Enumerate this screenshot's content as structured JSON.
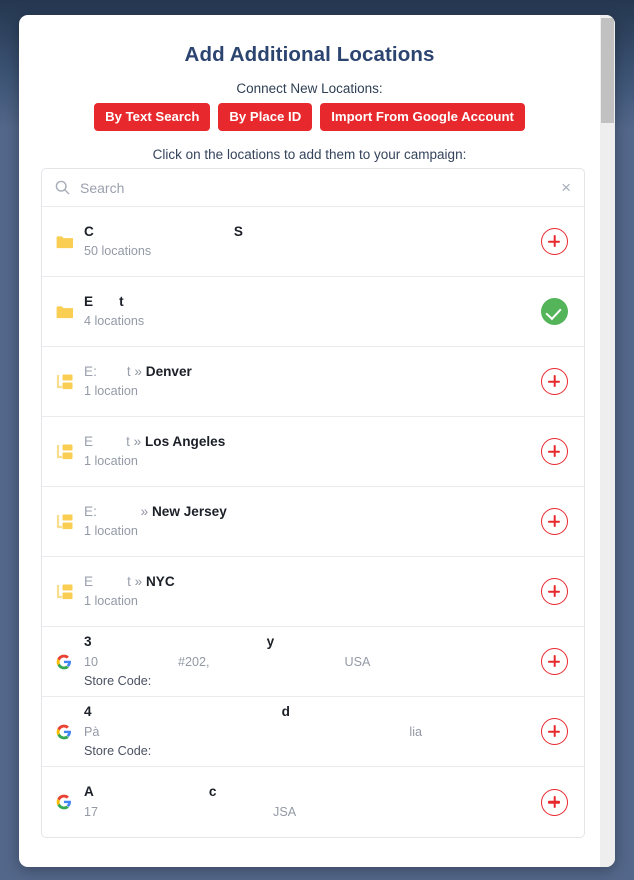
{
  "modal": {
    "title": "Add Additional Locations",
    "connect_label": "Connect New Locations:",
    "instruction": "Click on the locations to add them to your campaign:",
    "buttons": {
      "text_search": "By Text Search",
      "place_id": "By Place ID",
      "import_google": "Import From Google Account"
    }
  },
  "search": {
    "placeholder": "Search",
    "value": "",
    "clear_label": "×",
    "icon": "search-icon"
  },
  "colors": {
    "accent_red": "#e7282d",
    "success_green": "#54b45a",
    "title_navy": "#2c4470",
    "folder_yellow": "#f7c948",
    "backdrop": "#53678a"
  },
  "list": [
    {
      "icon": "folder-icon",
      "name_prefix": "C",
      "name_gap": 140,
      "name_suffix": "S",
      "count": "50 locations",
      "action": "add",
      "action_label": "+"
    },
    {
      "icon": "folder-icon",
      "name_prefix": "E",
      "name_gap": 26,
      "name_suffix": "t",
      "count": "4 locations",
      "action": "done",
      "action_label": "✓"
    },
    {
      "icon": "subfolder-icon",
      "parent_prefix": "E:",
      "parent_gap": 30,
      "parent_suffix": "t",
      "separator": "»",
      "child": "Denver",
      "count": "1 location",
      "action": "add",
      "action_label": "+"
    },
    {
      "icon": "subfolder-icon",
      "parent_prefix": "E",
      "parent_gap": 33,
      "parent_suffix": "t",
      "separator": "»",
      "child": "Los Angeles",
      "count": "1 location",
      "action": "add",
      "action_label": "+"
    },
    {
      "icon": "subfolder-icon",
      "parent_prefix": "E:",
      "parent_gap": 40,
      "parent_suffix": "",
      "separator": "»",
      "child": "New Jersey",
      "count": "1 location",
      "action": "add",
      "action_label": "+"
    },
    {
      "icon": "subfolder-icon",
      "parent_prefix": "E",
      "parent_gap": 34,
      "parent_suffix": "t",
      "separator": "»",
      "child": "NYC",
      "count": "1 location",
      "action": "add",
      "action_label": "+"
    },
    {
      "icon": "google-icon",
      "name_prefix": "3",
      "name_gap": 175,
      "name_suffix": "y",
      "addr_prefix": "10",
      "addr_gap1": 80,
      "addr_mid": "#202,",
      "addr_gap2": 135,
      "addr_suffix": "USA",
      "store_code": "Store Code:",
      "action": "add",
      "action_label": "+"
    },
    {
      "icon": "google-icon",
      "name_prefix": "4",
      "name_gap": 190,
      "name_suffix": "d",
      "addr_prefix": "Pà",
      "addr_gap1": 310,
      "addr_mid": "lia",
      "addr_gap2": 0,
      "addr_suffix": "",
      "store_code": "Store Code:",
      "action": "add",
      "action_label": "+"
    },
    {
      "icon": "google-icon",
      "name_prefix": "A",
      "name_gap": 115,
      "name_suffix": "c",
      "addr_prefix": "17",
      "addr_gap1": 175,
      "addr_mid": "JSA",
      "addr_gap2": 0,
      "addr_suffix": "",
      "action": "add",
      "action_label": "+"
    }
  ]
}
